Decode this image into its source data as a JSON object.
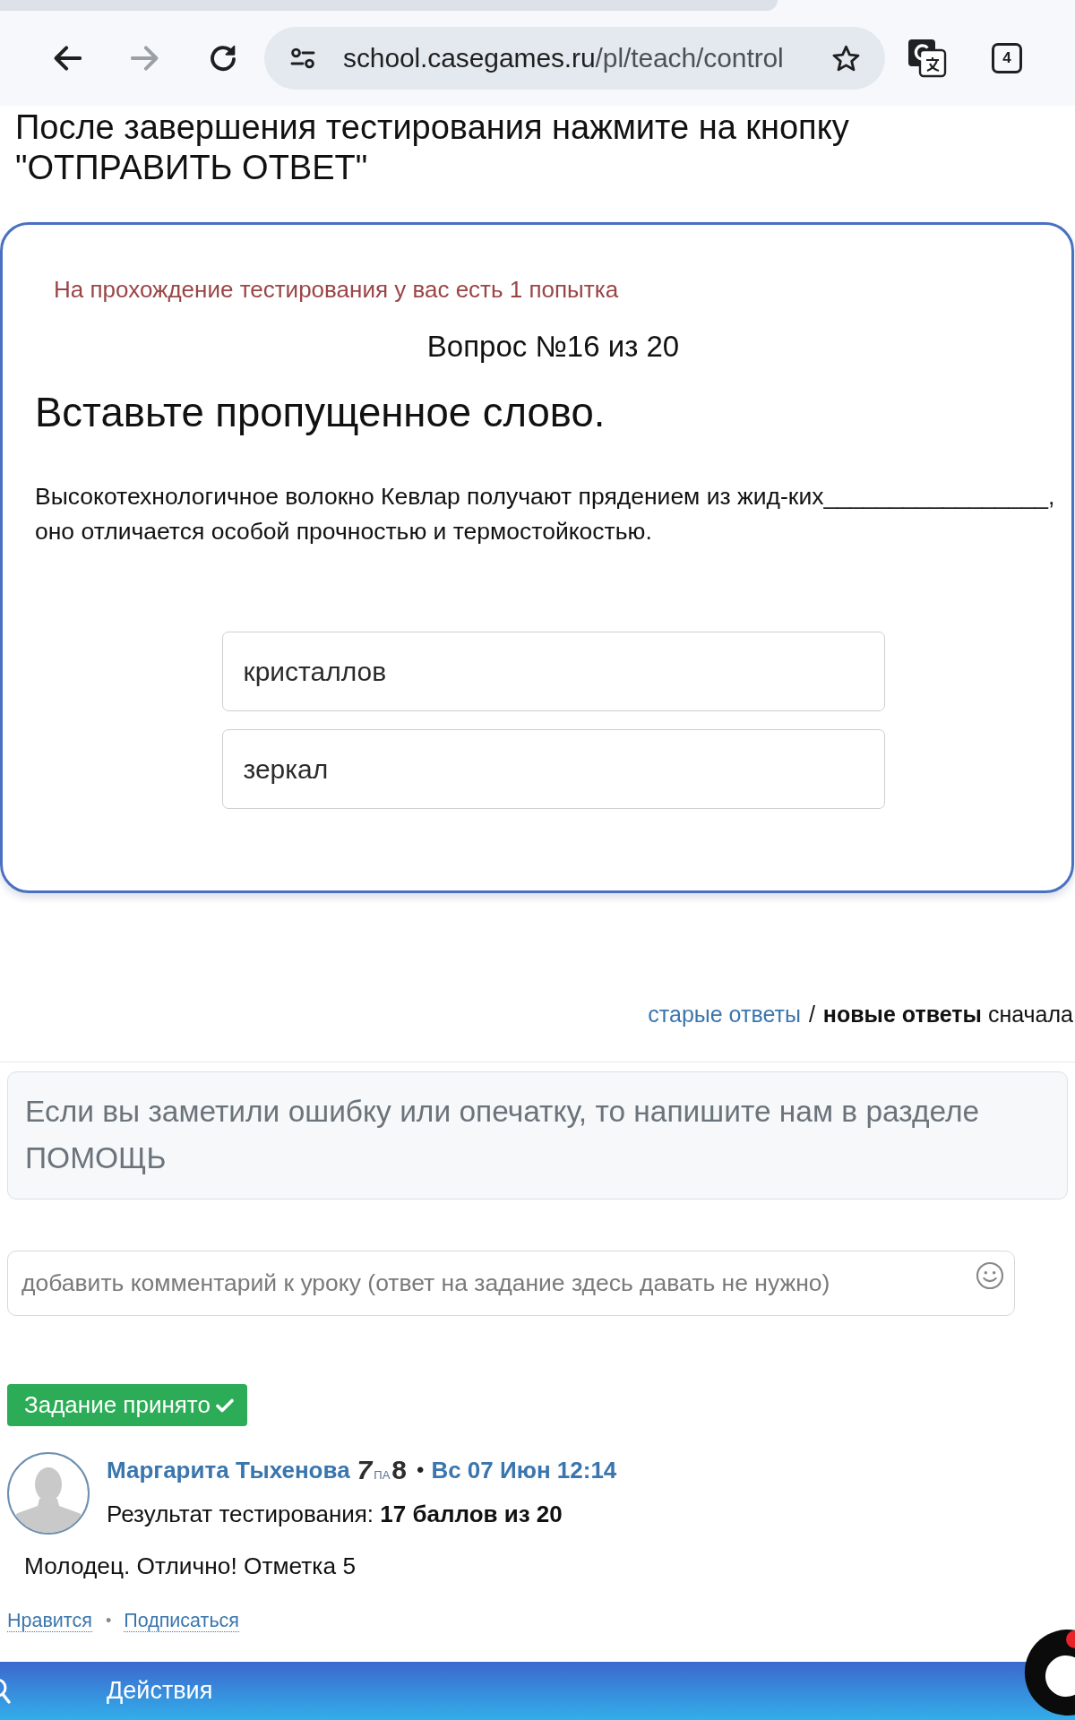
{
  "browser": {
    "url": {
      "domain": "school.casegames.ru",
      "path": "/pl/teach/control"
    },
    "forward_disabled": true,
    "tab_count": "4"
  },
  "instruction": "После завершения тестирования нажмите на кнопку \"ОТПРАВИТЬ ОТВЕТ\"",
  "test_card": {
    "attempts_note": "На прохождение тестирования у вас есть 1 попытка",
    "question_number": "Вопрос №16 из 20",
    "task": "Вставьте пропущенное слово.",
    "question_text": "Высокотехнологичное волокно Кевлар получают прядением из жид-ких_________________, оно отличается особой прочностью и термостойкостью.",
    "options": [
      {
        "label": "кристаллов"
      },
      {
        "label": "зеркал"
      }
    ]
  },
  "sort": {
    "options": [
      {
        "label": "старые ответы",
        "selected": false
      },
      {
        "label": "новые ответы",
        "selected": true
      }
    ],
    "separator": "/",
    "suffix": "сначала"
  },
  "help_notice": "Если вы заметили ошибку или опечатку, то напишите нам в разделе ПОМОЩЬ",
  "comment_field": {
    "placeholder": "добавить комментарий к уроку (ответ на задание здесь давать не нужно)"
  },
  "status_badge": {
    "label": "Задание принято"
  },
  "comment": {
    "author": "Маргарита Тыхенова",
    "author_badge": [
      "7",
      "ПА",
      "8"
    ],
    "separator": "•",
    "date": "Вс 07 Июн 12:14",
    "result": "Результат тестирования: **17 баллов из 20**",
    "text": "Молодец. Отлично! Отметка 5",
    "actions": [
      {
        "label": "Нравится"
      },
      {
        "label": "Подписаться"
      }
    ],
    "actions_separator": "•"
  },
  "bottom_bar": {
    "label": "Действия"
  },
  "chat_widget": {
    "unread": true
  }
}
